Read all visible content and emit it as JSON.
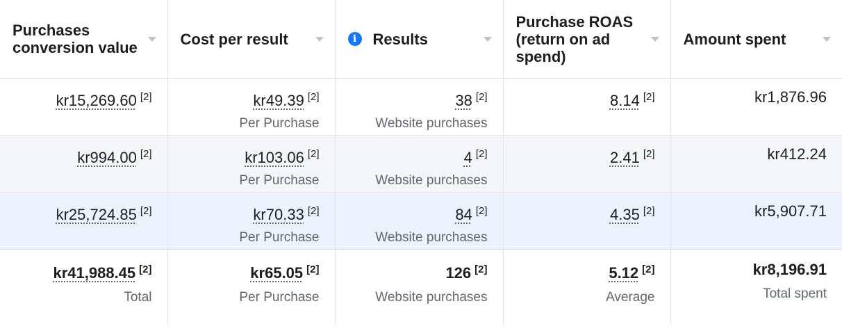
{
  "columns": [
    {
      "label": "Purchases conversion value",
      "info": false
    },
    {
      "label": "Cost per result",
      "info": false
    },
    {
      "label": "Results",
      "info": true
    },
    {
      "label": "Purchase ROAS (return on ad spend)",
      "info": false
    },
    {
      "label": "Amount spent",
      "info": false
    }
  ],
  "info_glyph": "i",
  "rows": [
    {
      "conversion_value": "kr15,269.60",
      "conversion_ref": "[2]",
      "cost_per_result": "kr49.39",
      "cost_ref": "[2]",
      "cost_sub": "Per Purchase",
      "results": "38",
      "results_ref": "[2]",
      "results_sub": "Website purchases",
      "roas": "8.14",
      "roas_ref": "[2]",
      "amount_spent": "kr1,876.96"
    },
    {
      "conversion_value": "kr994.00",
      "conversion_ref": "[2]",
      "cost_per_result": "kr103.06",
      "cost_ref": "[2]",
      "cost_sub": "Per Purchase",
      "results": "4",
      "results_ref": "[2]",
      "results_sub": "Website purchases",
      "roas": "2.41",
      "roas_ref": "[2]",
      "amount_spent": "kr412.24"
    },
    {
      "conversion_value": "kr25,724.85",
      "conversion_ref": "[2]",
      "cost_per_result": "kr70.33",
      "cost_ref": "[2]",
      "cost_sub": "Per Purchase",
      "results": "84",
      "results_ref": "[2]",
      "results_sub": "Website purchases",
      "roas": "4.35",
      "roas_ref": "[2]",
      "amount_spent": "kr5,907.71"
    }
  ],
  "totals": {
    "conversion_value": "kr41,988.45",
    "conversion_ref": "[2]",
    "conversion_sub": "Total",
    "cost_per_result": "kr65.05",
    "cost_ref": "[2]",
    "cost_sub": "Per Purchase",
    "results": "126",
    "results_ref": "[2]",
    "results_sub": "Website purchases",
    "roas": "5.12",
    "roas_ref": "[2]",
    "roas_sub": "Average",
    "amount_spent": "kr8,196.91",
    "amount_sub": "Total spent"
  },
  "colors": {
    "info_icon": "#1877f2",
    "row_alt": "#f5f6f7",
    "row_highlight": "#ecf3ff",
    "secondary_text": "#606770"
  }
}
